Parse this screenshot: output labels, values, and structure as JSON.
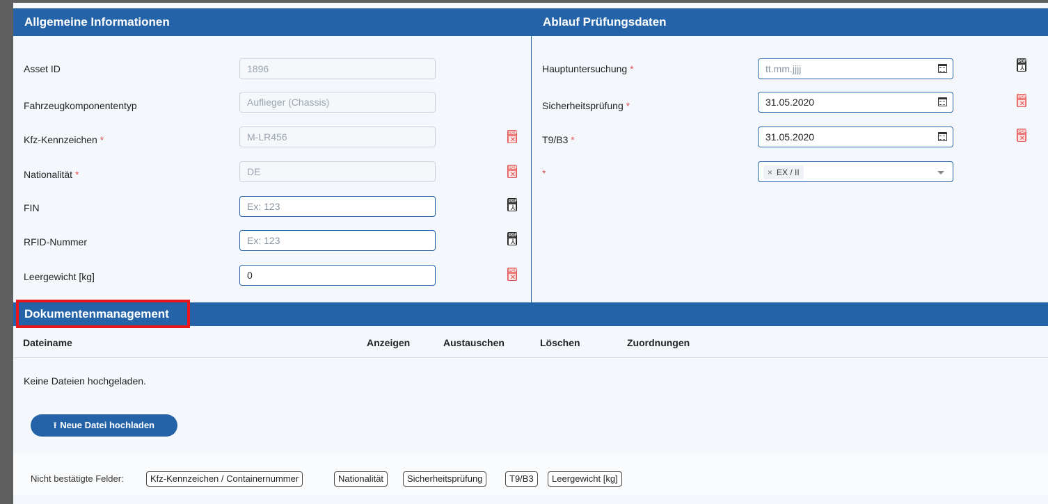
{
  "general": {
    "header": "Allgemeine Informationen",
    "fields": [
      {
        "label": "Asset ID",
        "required": "",
        "value": "1896"
      },
      {
        "label": "Fahrzeugkomponententyp",
        "required": "",
        "value": "Auflieger (Chassis)"
      },
      {
        "label": "Kfz-Kennzeichen",
        "required": "*",
        "value": "M-LR456"
      },
      {
        "label": "Nationalität",
        "required": "*",
        "value": "DE"
      },
      {
        "label": "FIN",
        "required": "",
        "placeholder": "Ex: 123"
      },
      {
        "label": "RFID-Nummer",
        "required": "",
        "placeholder": "Ex: 123"
      },
      {
        "label": "Leergewicht [kg]",
        "required": "",
        "value": "0"
      }
    ]
  },
  "exam": {
    "header": "Ablauf Prüfungsdaten",
    "fields": [
      {
        "label": "Hauptuntersuchung",
        "required": "*",
        "placeholder": "tt.mm.jjjj"
      },
      {
        "label": "Sicherheitsprüfung",
        "required": "*",
        "value": "31.05.2020"
      },
      {
        "label": "T9/B3",
        "required": "*",
        "value": "31.05.2020"
      },
      {
        "label": "",
        "required": "*",
        "tag": "EX / II",
        "tag_remove": "×"
      }
    ]
  },
  "pdf": {
    "label": "PDF",
    "dark_mark": "⅄",
    "red_mark": "✕"
  },
  "docs": {
    "header": "Dokumentenmanagement",
    "columns": [
      "Dateiname",
      "Anzeigen",
      "Austauschen",
      "Löschen",
      "Zuordnungen"
    ],
    "empty": "Keine Dateien hochgeladen.",
    "upload_icon": "⭱",
    "upload_label": "Neue Datei hochladen"
  },
  "unconfirmed": {
    "label": "Nicht bestätigte Felder:",
    "chips": [
      "Kfz-Kennzeichen / Containernummer",
      "Nationalität",
      "Sicherheitsprüfung",
      "T9/B3",
      "Leergewicht [kg]"
    ]
  },
  "colors": {
    "header_bg": "#2563a8",
    "highlight": "#e8161b",
    "required": "#e05050"
  }
}
